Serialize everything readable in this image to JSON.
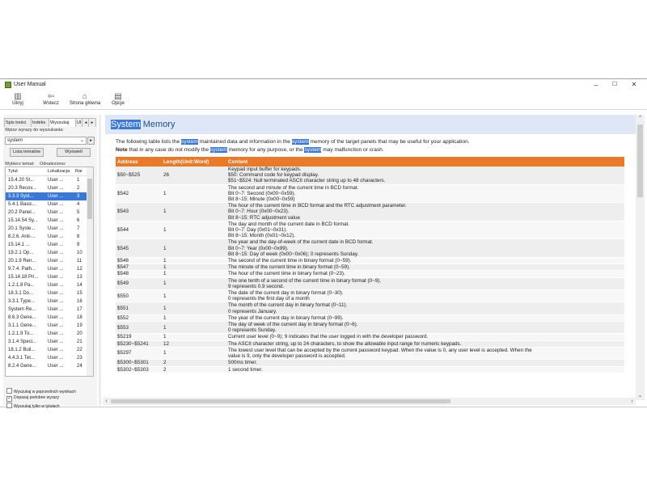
{
  "window": {
    "title": "User Manual",
    "minimize": "–",
    "maximize": "☐",
    "close": "✕"
  },
  "toolbar": [
    {
      "label": "Ukryj",
      "icon": "hide-icon"
    },
    {
      "label": "Wstecz",
      "icon": "back-icon"
    },
    {
      "label": "Strona główna",
      "icon": "home-icon"
    },
    {
      "label": "Opcje",
      "icon": "options-icon"
    }
  ],
  "left": {
    "tabs": [
      "Spis treści",
      "Indeks",
      "Wyszukaj",
      "Ul"
    ],
    "prompt": "Wpisz wyrazy do wyszukania:",
    "search_value": "system",
    "list_topics_btn": "Lista tematów",
    "display_btn": "Wyświetl",
    "select_topic": "Wybierz temat:",
    "found": "Odnaleziono:",
    "columns": [
      "Tytuł",
      "Lokalizacja",
      "Rar"
    ],
    "rows": [
      [
        "15.4.20 St...",
        "User ...",
        "1"
      ],
      [
        "20.3 Recov...",
        "User ...",
        "2"
      ],
      [
        "3.3.3 Syst...",
        "User ...",
        "3"
      ],
      [
        "5.4.1 Basic...",
        "User ...",
        "4"
      ],
      [
        "20.2 Panel...",
        "User ...",
        "5"
      ],
      [
        "15.14.54 Sy...",
        "User ...",
        "6"
      ],
      [
        "20.1 Syste...",
        "User ...",
        "7"
      ],
      [
        "8.2.6. Anti-...",
        "User ...",
        "8"
      ],
      [
        "15.14.1 ...",
        "User ...",
        "9"
      ],
      [
        "19.2.1 Op...",
        "User ...",
        "10"
      ],
      [
        "20.1.9 Ren...",
        "User ...",
        "11"
      ],
      [
        "9.7.4. Path...",
        "User ...",
        "12"
      ],
      [
        "15.14.18 Pri...",
        "User ...",
        "13"
      ],
      [
        "1.2.1.8 Pa...",
        "User ...",
        "14"
      ],
      [
        "18.3.1 Do...",
        "User ...",
        "15"
      ],
      [
        "3.3.1 Type...",
        "User ...",
        "16"
      ],
      [
        "System Re...",
        "User ...",
        "17"
      ],
      [
        "8.6.3 Gene...",
        "User ...",
        "18"
      ],
      [
        "3.1.1 Gene...",
        "User ...",
        "19"
      ],
      [
        "1.2.1.9 To...",
        "User ...",
        "20"
      ],
      [
        "3.1.4 Speci...",
        "User ...",
        "21"
      ],
      [
        "18.1.2 Buil...",
        "User ...",
        "22"
      ],
      [
        "4.4.3.1 Tet...",
        "User ...",
        "23"
      ],
      [
        "8.2.4 Gene...",
        "User ...",
        "24"
      ]
    ],
    "selected_index": 2,
    "checks": [
      {
        "label": "Wyszukaj w poprzednich wynikach",
        "checked": false
      },
      {
        "label": "Dopasuj podobne wyrazy",
        "checked": true
      },
      {
        "label": "Wyszukaj tylko w tytułach",
        "checked": false
      }
    ]
  },
  "content": {
    "title_hl": "System",
    "title_rest": " Memory",
    "p1": [
      "The following table lists the ",
      "system",
      " maintained data and information in the ",
      "system",
      " memory of the target panels that may be useful for your application."
    ],
    "p2": [
      "Note",
      " that in any case do not modify the ",
      "system",
      " memory for any purpose, or the ",
      "system",
      " may malfunction or crash."
    ],
    "table_headers": [
      "Address",
      "Length(Unit:Word)",
      "Content"
    ],
    "table_rows": [
      [
        "$50~$525",
        "26",
        "Keypad input buffer for keypads.\n$50: Command code for keypad display.\n$51~$524: Null terminated ASCII character string up to 48 characters."
      ],
      [
        "$542",
        "1",
        "The second and minute of the current time in BCD format.\nBit 0~7: Second (0x00~0x59).\nBit 8~15: Minute (0x00~0x59)"
      ],
      [
        "$543",
        "1",
        "The hour of the current time in BCD format and the RTC adjustment parameter.\nBit 0~7: Hour (0x00~0x23).\nBit 8~15: RTC adjustment value"
      ],
      [
        "$544",
        "1",
        "The day and month of the current date in BCD format.\nBit 0~7: Day (0x01~0x31).\nBit 8~15: Month (0x01~0x12)."
      ],
      [
        "$545",
        "1",
        "The year and the day-of-week of the current date in BCD format.\nBit 0~7: Year (0x00~0x99).\nBit 8~15: Day of week (0x00~0x06); 0 represents Sunday."
      ],
      [
        "$546",
        "1",
        "The second of the current time in binary format (0~59)."
      ],
      [
        "$547",
        "1",
        "The minute of the current time in binary format (0~59)."
      ],
      [
        "$548",
        "1",
        "The hour of the current time in binary format (0~23)."
      ],
      [
        "$549",
        "1",
        "The one tenth of a second of the current time in binary format (0~9).\n9 represents 0.9 second."
      ],
      [
        "$550",
        "1",
        "The date of the current day in binary format (0~30).\n0 represents the first day of a month"
      ],
      [
        "$551",
        "1",
        "The month of the current day in binary format (0~11).\n0 represents January."
      ],
      [
        "$552",
        "1",
        "The year of the current day in binary format (0~99)."
      ],
      [
        "$553",
        "1",
        "The day of week of the current day in binary format (0~6).\n0 represents Sunday."
      ],
      [
        "$5219",
        "1",
        "Current user level (0~9); 9 indicates that the user logged in with the developer password."
      ],
      [
        "$5230~$5241",
        "12",
        "The ASCII character string, up to 24 characters, to show the allowable input range for numeric keypads."
      ],
      [
        "$5297",
        "1",
        "The lowest user level that can be accepted by the current password keypad. When the value is 0, any user level is accepted. When the\nvalue is 9, only the developer password is accepted."
      ],
      [
        "$5300~$5301",
        "2",
        "500ms timer."
      ],
      [
        "$5302~$5303",
        "2",
        "1 second timer."
      ]
    ]
  }
}
